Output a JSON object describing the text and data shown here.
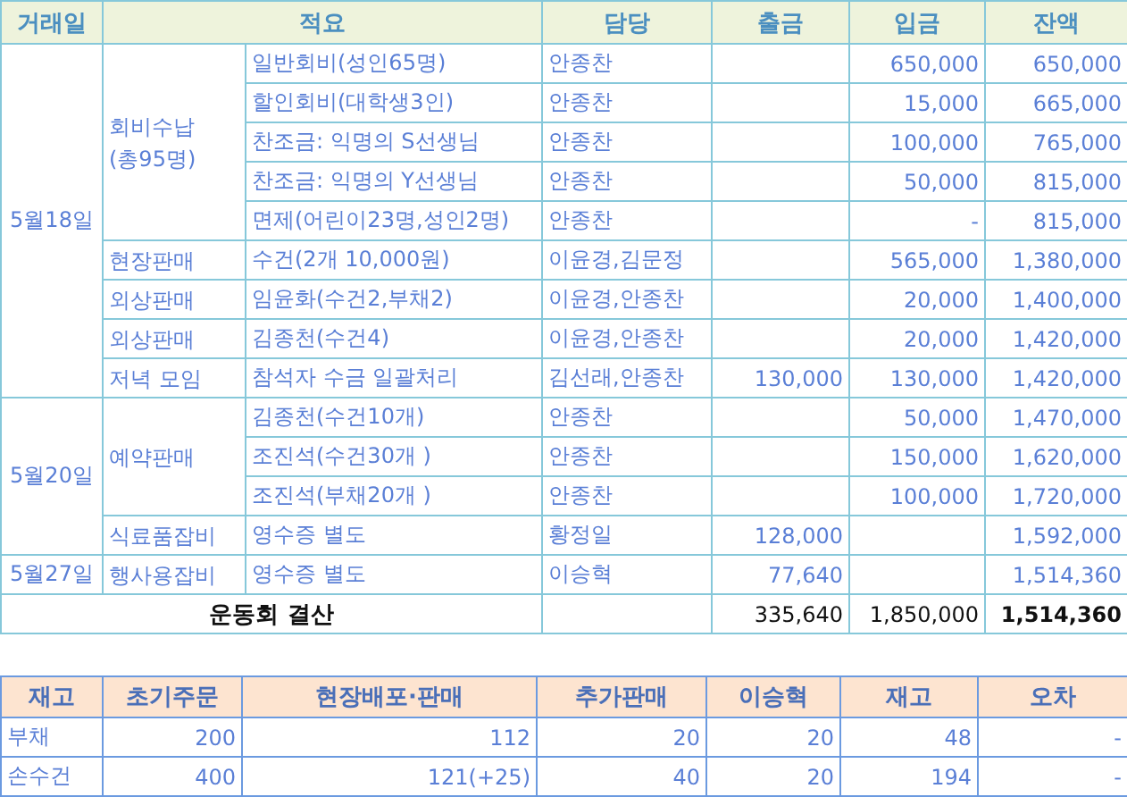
{
  "ledger": {
    "columns": [
      "거래일",
      "적요",
      "담당",
      "출금",
      "입금",
      "잔액"
    ],
    "dates": [
      {
        "date": "5월18일",
        "categories": [
          {
            "name": "회비수납",
            "note": "(총95명)",
            "items": [
              {
                "detail": "일반회비(성인65명)",
                "person": "안종찬",
                "deposit": "650,000",
                "balance": "650,000"
              },
              {
                "detail": "할인회비(대학생3인)",
                "person": "안종찬",
                "deposit": "15,000",
                "balance": "665,000"
              },
              {
                "detail": "찬조금: 익명의 S선생님",
                "person": "안종찬",
                "deposit": "100,000",
                "balance": "765,000"
              },
              {
                "detail": "찬조금: 익명의 Y선생님",
                "person": "안종찬",
                "deposit": "50,000",
                "balance": "815,000"
              },
              {
                "detail": "면제(어린이23명,성인2명)",
                "person": "안종찬",
                "deposit": "-",
                "balance": "815,000"
              }
            ]
          },
          {
            "name": "현장판매",
            "items": [
              {
                "detail": "수건(2개 10,000원)",
                "person": "이윤경,김문정",
                "deposit": "565,000",
                "balance": "1,380,000"
              }
            ]
          },
          {
            "name": "외상판매",
            "items": [
              {
                "detail": "임윤화(수건2,부채2)",
                "person": "이윤경,안종찬",
                "deposit": "20,000",
                "balance": "1,400,000"
              }
            ]
          },
          {
            "name": "외상판매",
            "items": [
              {
                "detail": "김종천(수건4)",
                "person": "이윤경,안종찬",
                "deposit": "20,000",
                "balance": "1,420,000"
              }
            ]
          },
          {
            "name": "저녁 모임",
            "items": [
              {
                "detail": "참석자 수금 일괄처리",
                "person": "김선래,안종찬",
                "withdrawal": "130,000",
                "deposit": "130,000",
                "balance": "1,420,000"
              }
            ]
          }
        ]
      },
      {
        "date": "5월20일",
        "categories": [
          {
            "name": "예약판매",
            "items": [
              {
                "detail": "김종천(수건10개)",
                "person": "안종찬",
                "deposit": "50,000",
                "balance": "1,470,000"
              },
              {
                "detail": "조진석(수건30개 )",
                "person": "안종찬",
                "deposit": "150,000",
                "balance": "1,620,000"
              },
              {
                "detail": "조진석(부채20개 )",
                "person": "안종찬",
                "deposit": "100,000",
                "balance": "1,720,000"
              }
            ]
          },
          {
            "name": "식료품잡비",
            "items": [
              {
                "detail": "영수증 별도",
                "person": "황정일",
                "withdrawal": "128,000",
                "balance": "1,592,000"
              }
            ]
          }
        ]
      },
      {
        "date": "5월27일",
        "categories": [
          {
            "name": "행사용잡비",
            "items": [
              {
                "detail": "영수증 별도",
                "person": "이승혁",
                "withdrawal": "77,640",
                "balance": "1,514,360"
              }
            ]
          }
        ]
      }
    ],
    "total": {
      "label": "운동회 결산",
      "withdrawal": "335,640",
      "deposit": "1,850,000",
      "balance": "1,514,360"
    }
  },
  "inventory": {
    "columns": [
      "재고",
      "초기주문",
      "현장배포·판매",
      "추가판매",
      "이승혁",
      "재고",
      "오차"
    ],
    "rows": [
      [
        "부채",
        "200",
        "112",
        "20",
        "20",
        "48",
        "-"
      ],
      [
        "손수건",
        "400",
        "121(+25)",
        "40",
        "20",
        "194",
        "-"
      ]
    ]
  }
}
